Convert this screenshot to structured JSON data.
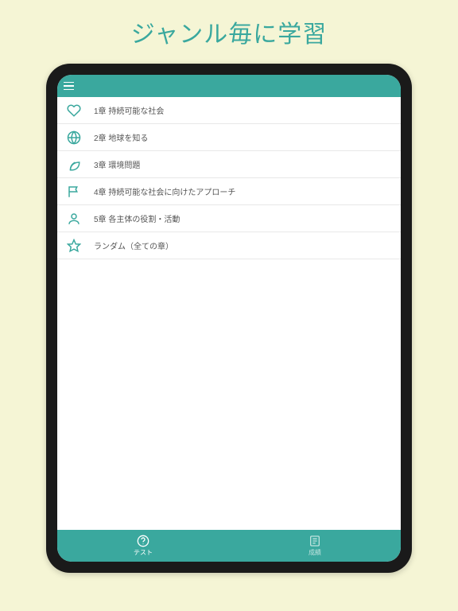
{
  "page_title": "ジャンル毎に学習",
  "colors": {
    "accent": "#3aa89e",
    "page_bg": "#f5f5d5"
  },
  "list": [
    {
      "icon": "heart-icon",
      "label": "1章 持続可能な社会"
    },
    {
      "icon": "globe-icon",
      "label": "2章 地球を知る"
    },
    {
      "icon": "leaf-icon",
      "label": "3章 環境問題"
    },
    {
      "icon": "flag-icon",
      "label": "4章 持続可能な社会に向けたアプローチ"
    },
    {
      "icon": "person-icon",
      "label": "5章 各主体の役割・活動"
    },
    {
      "icon": "star-icon",
      "label": "ランダム（全ての章）"
    }
  ],
  "tabs": [
    {
      "icon": "help-icon",
      "label": "テスト",
      "active": true
    },
    {
      "icon": "list-icon",
      "label": "成績",
      "active": false
    }
  ]
}
